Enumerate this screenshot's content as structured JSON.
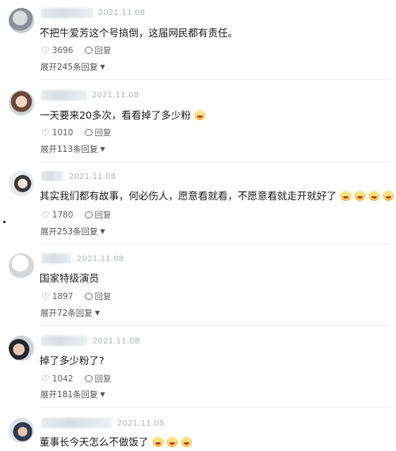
{
  "comments": [
    {
      "time": "2021.11.08",
      "text": "不把牛爱芳这个号搞倒，这届网民都有责任。",
      "likes": "3696",
      "reply": "回复",
      "expand": "展开245条回复"
    },
    {
      "time": "2021.11.08",
      "text": "一天要来20多次，看看掉了多少粉",
      "likes": "1010",
      "reply": "回复",
      "expand": "展开113条回复"
    },
    {
      "time": "2021.11.08",
      "text": "其实我们都有故事，何必伤人，愿意看就看，不愿意看就走开就好了",
      "likes": "1780",
      "reply": "回复",
      "expand": "展开253条回复"
    },
    {
      "time": "2021.11.08",
      "text": "国家特级演员",
      "likes": "1897",
      "reply": "回复",
      "expand": "展开72条回复"
    },
    {
      "time": "2021.11.08",
      "text": "掉了多少粉了?",
      "likes": "1042",
      "reply": "回复",
      "expand": "展开181条回复"
    },
    {
      "time": "2021.11.08",
      "text": "董事长今天怎么不做饭了"
    }
  ]
}
